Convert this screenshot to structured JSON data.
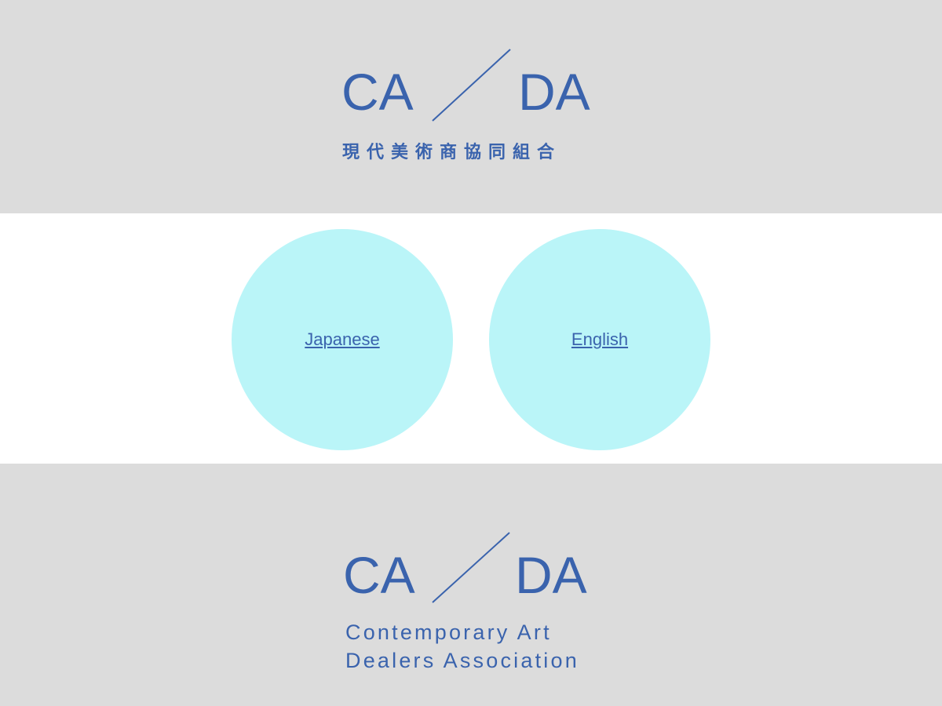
{
  "header": {
    "logo_left": "CA",
    "logo_right": "DA",
    "subtitle": "現代美術商協同組合"
  },
  "language": {
    "japanese_label": "Japanese",
    "english_label": "English"
  },
  "footer": {
    "logo_left": "CA",
    "logo_right": "DA",
    "line1": "Contemporary Art",
    "line2": "Dealers Association"
  },
  "colors": {
    "brand_blue": "#3a63ad",
    "band_gray": "#dcdcdc",
    "circle_cyan": "#baf5f8"
  }
}
